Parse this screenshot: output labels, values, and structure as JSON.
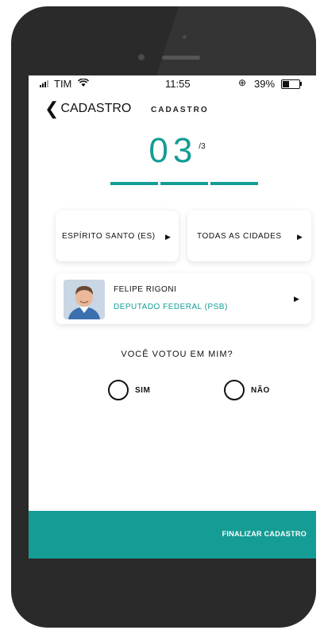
{
  "status_bar": {
    "carrier": "TIM",
    "time": "11:55",
    "battery": "39%",
    "wifi_icon": "wifi-icon",
    "alarm_icon": "alarm-icon"
  },
  "nav": {
    "back_label": "CADASTRO",
    "title": "CADASTRO"
  },
  "step": {
    "current": "03",
    "total": "/3"
  },
  "progress": {
    "segments_filled": 3,
    "segments_total": 3
  },
  "filters": {
    "state": "ESPÍRITO SANTO (ES)",
    "city": "TODAS AS CIDADES"
  },
  "candidate": {
    "name": "FELIPE RIGONI",
    "role": "DEPUTADO FEDERAL (PSB)"
  },
  "vote": {
    "question": "VOCÊ VOTOU EM MIM?",
    "yes": "SIM",
    "no": "NÃO"
  },
  "finish_button": "FINALIZAR CADASTRO",
  "colors": {
    "accent": "#159c95",
    "phone_body": "#2a2a2a"
  }
}
